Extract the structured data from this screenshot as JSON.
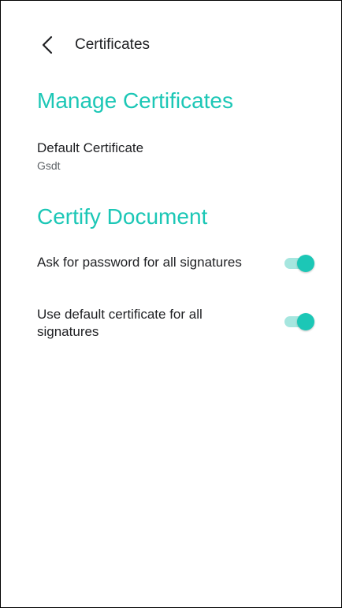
{
  "header": {
    "title": "Certificates",
    "back_icon": "chevron-left-icon"
  },
  "manage_certificates": {
    "title": "Manage Certificates",
    "default_certificate": {
      "label": "Default Certificate",
      "value": "Gsdt"
    }
  },
  "certify_document": {
    "title": "Certify Document",
    "settings": [
      {
        "label": "Ask for password for all signatures",
        "enabled": true
      },
      {
        "label": "Use default certificate for all signatures",
        "enabled": true
      }
    ]
  },
  "colors": {
    "accent": "#1cc7b6",
    "switch_track": "#a6e6df",
    "text_primary": "#202124",
    "text_secondary": "#5f6368"
  }
}
